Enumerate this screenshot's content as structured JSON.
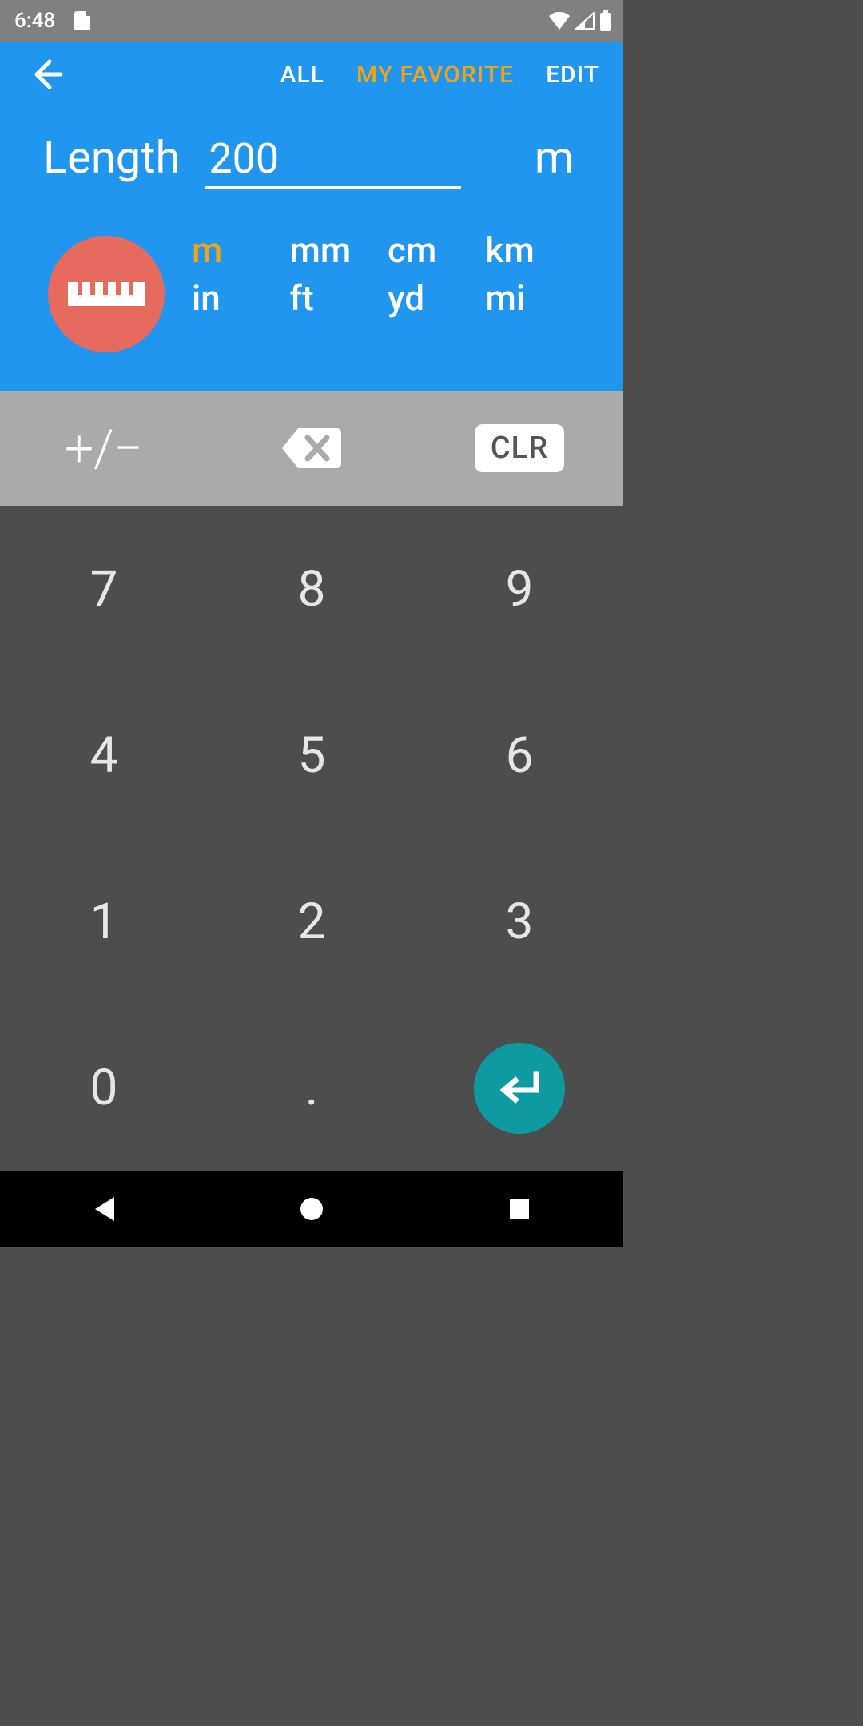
{
  "status": {
    "time": "6:48"
  },
  "tabs": {
    "all": "ALL",
    "favorite": "MY FAVORITE",
    "edit": "EDIT"
  },
  "converter": {
    "category": "Length",
    "value": "200",
    "current_unit": "m",
    "units": [
      "m",
      "mm",
      "cm",
      "km",
      "in",
      "ft",
      "yd",
      "mi"
    ],
    "selected_index": 0
  },
  "funcs": {
    "plusminus": "+/−",
    "clear": "CLR"
  },
  "keypad": {
    "k7": "7",
    "k8": "8",
    "k9": "9",
    "k4": "4",
    "k5": "5",
    "k6": "6",
    "k1": "1",
    "k2": "2",
    "k3": "3",
    "k0": "0",
    "dot": "."
  }
}
